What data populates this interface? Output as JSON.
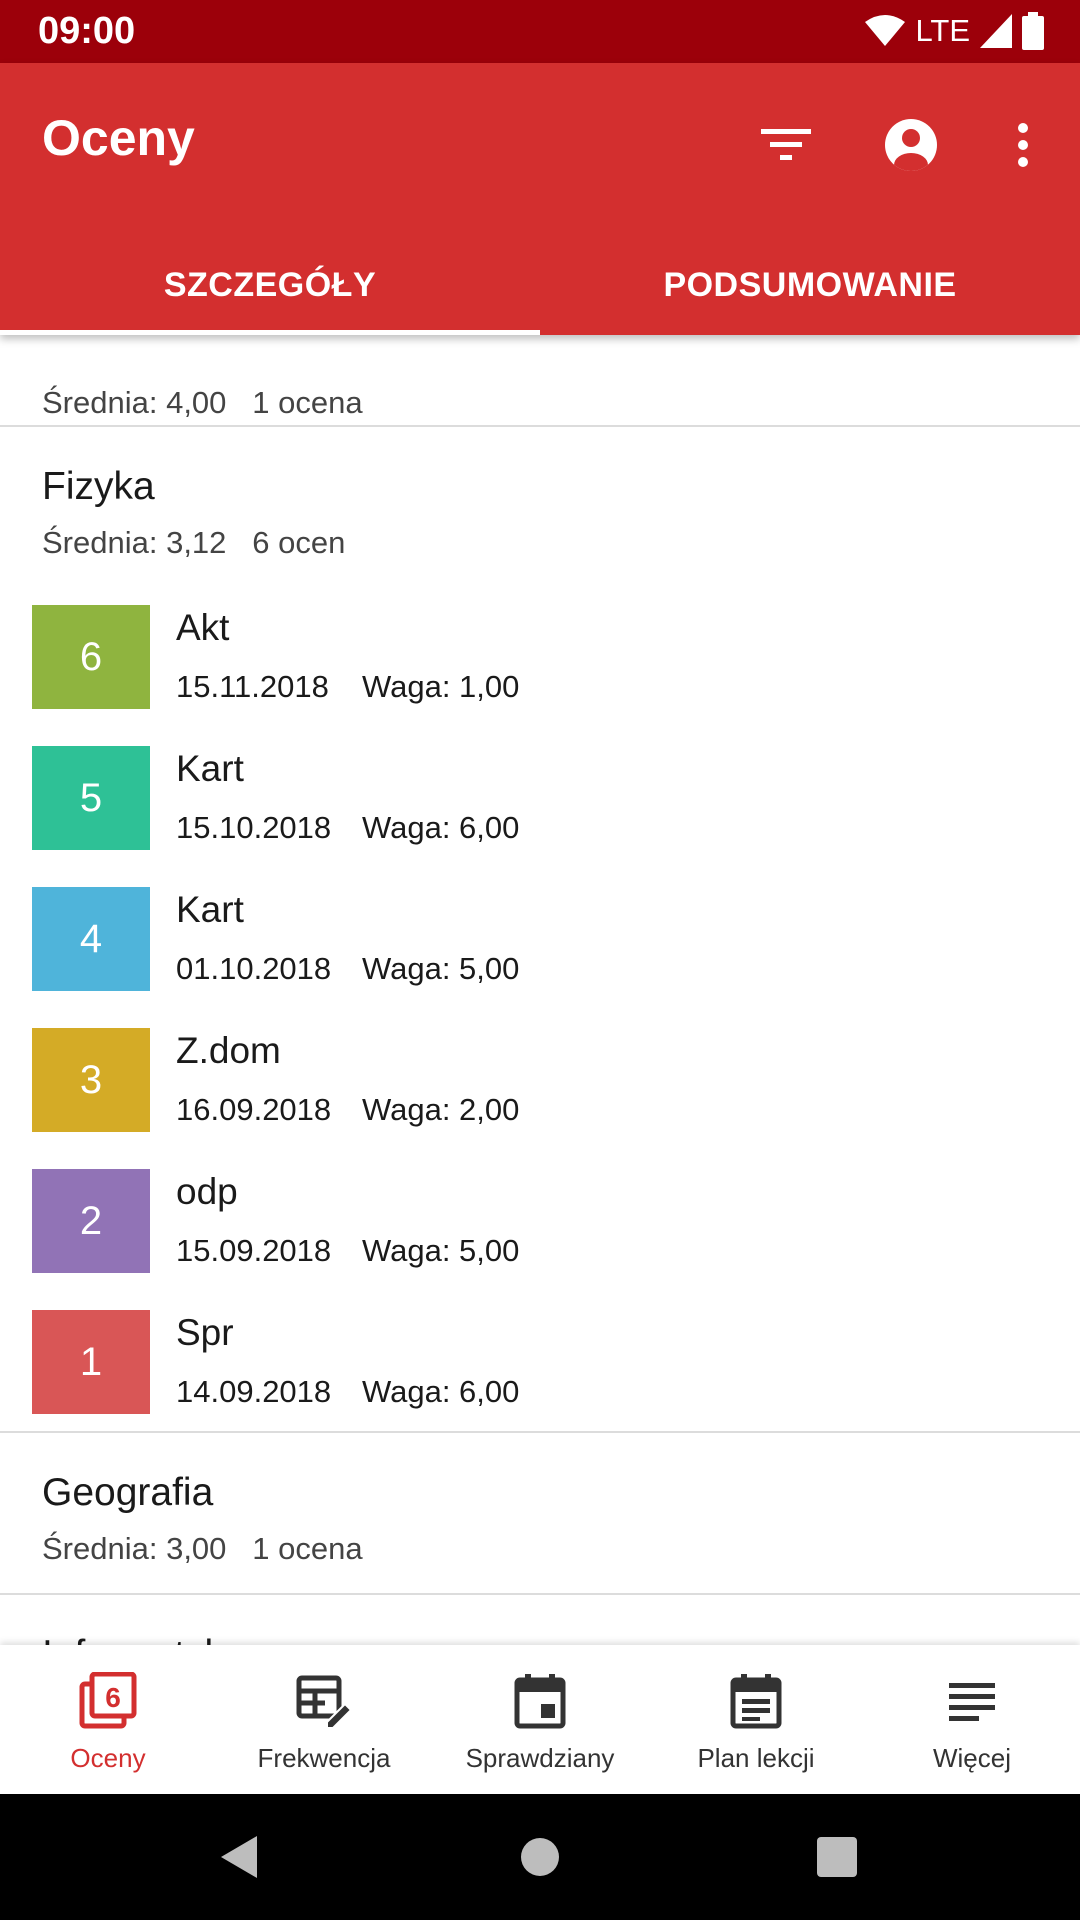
{
  "status_bar": {
    "time": "09:00",
    "network": "LTE"
  },
  "app_bar": {
    "title": "Oceny"
  },
  "tabs": [
    {
      "label": "SZCZEGÓŁY",
      "selected": true
    },
    {
      "label": "PODSUMOWANIE",
      "selected": false
    }
  ],
  "previous_subject": {
    "meta": "Średnia: 4,00   1 ocena"
  },
  "subjects": [
    {
      "name": "Fizyka",
      "meta": "Średnia: 3,12   6 ocen",
      "grades": [
        {
          "value": "6",
          "description": "Akt",
          "date": "15.11.2018",
          "weight": "Waga: 1,00",
          "color": "#8fb43f"
        },
        {
          "value": "5",
          "description": "Kart",
          "date": "15.10.2018",
          "weight": "Waga: 6,00",
          "color": "#2ec196"
        },
        {
          "value": "4",
          "description": "Kart",
          "date": "01.10.2018",
          "weight": "Waga: 5,00",
          "color": "#4fb4da"
        },
        {
          "value": "3",
          "description": "Z.dom",
          "date": "16.09.2018",
          "weight": "Waga: 2,00",
          "color": "#d4ab26"
        },
        {
          "value": "2",
          "description": "odp",
          "date": "15.09.2018",
          "weight": "Waga: 5,00",
          "color": "#9173b6"
        },
        {
          "value": "1",
          "description": "Spr",
          "date": "14.09.2018",
          "weight": "Waga: 6,00",
          "color": "#d95656"
        }
      ]
    },
    {
      "name": "Geografia",
      "meta": "Średnia: 3,00   1 ocena"
    },
    {
      "name": "Informatyka"
    }
  ],
  "bottom_nav": [
    {
      "label": "Oceny",
      "icon": "grades-icon",
      "active": true
    },
    {
      "label": "Frekwencja",
      "icon": "attendance-icon",
      "active": false
    },
    {
      "label": "Sprawdziany",
      "icon": "exams-icon",
      "active": false
    },
    {
      "label": "Plan lekcji",
      "icon": "timetable-icon",
      "active": false
    },
    {
      "label": "Więcej",
      "icon": "more-menu-icon",
      "active": false
    }
  ],
  "colors": {
    "primary": "#d32f2f",
    "status_bar": "#9c000a",
    "active_nav": "#d32f2f"
  }
}
